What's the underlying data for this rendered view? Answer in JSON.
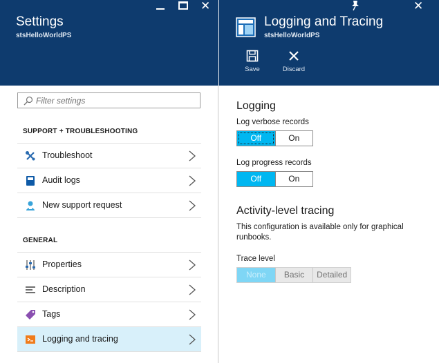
{
  "settings_blade": {
    "title": "Settings",
    "subtitle": "stsHelloWorldPS",
    "search_placeholder": "Filter settings",
    "sections": [
      {
        "heading": "SUPPORT + TROUBLESHOOTING",
        "items": [
          {
            "label": "Troubleshoot",
            "icon": "wrench-icon"
          },
          {
            "label": "Audit logs",
            "icon": "book-icon"
          },
          {
            "label": "New support request",
            "icon": "support-person-icon"
          }
        ]
      },
      {
        "heading": "GENERAL",
        "items": [
          {
            "label": "Properties",
            "icon": "sliders-icon"
          },
          {
            "label": "Description",
            "icon": "lines-icon"
          },
          {
            "label": "Tags",
            "icon": "tag-icon"
          },
          {
            "label": "Logging and tracing",
            "icon": "runbook-icon",
            "active": true
          }
        ]
      }
    ]
  },
  "logging_blade": {
    "title": "Logging and Tracing",
    "subtitle": "stsHelloWorldPS",
    "commands": {
      "save": "Save",
      "discard": "Discard"
    },
    "logging": {
      "heading": "Logging",
      "verbose": {
        "label": "Log verbose records",
        "off": "Off",
        "on": "On",
        "value": "Off"
      },
      "progress": {
        "label": "Log progress records",
        "off": "Off",
        "on": "On",
        "value": "Off"
      }
    },
    "tracing": {
      "heading": "Activity-level tracing",
      "help": "This configuration is available only for graphical runbooks.",
      "trace_label": "Trace level",
      "options": [
        "None",
        "Basic",
        "Detailed"
      ],
      "value": "None"
    }
  },
  "colors": {
    "header_bg": "#0e3b6e",
    "toggle_selected": "#00b7f1",
    "active_item_bg": "#d8f0fa"
  }
}
